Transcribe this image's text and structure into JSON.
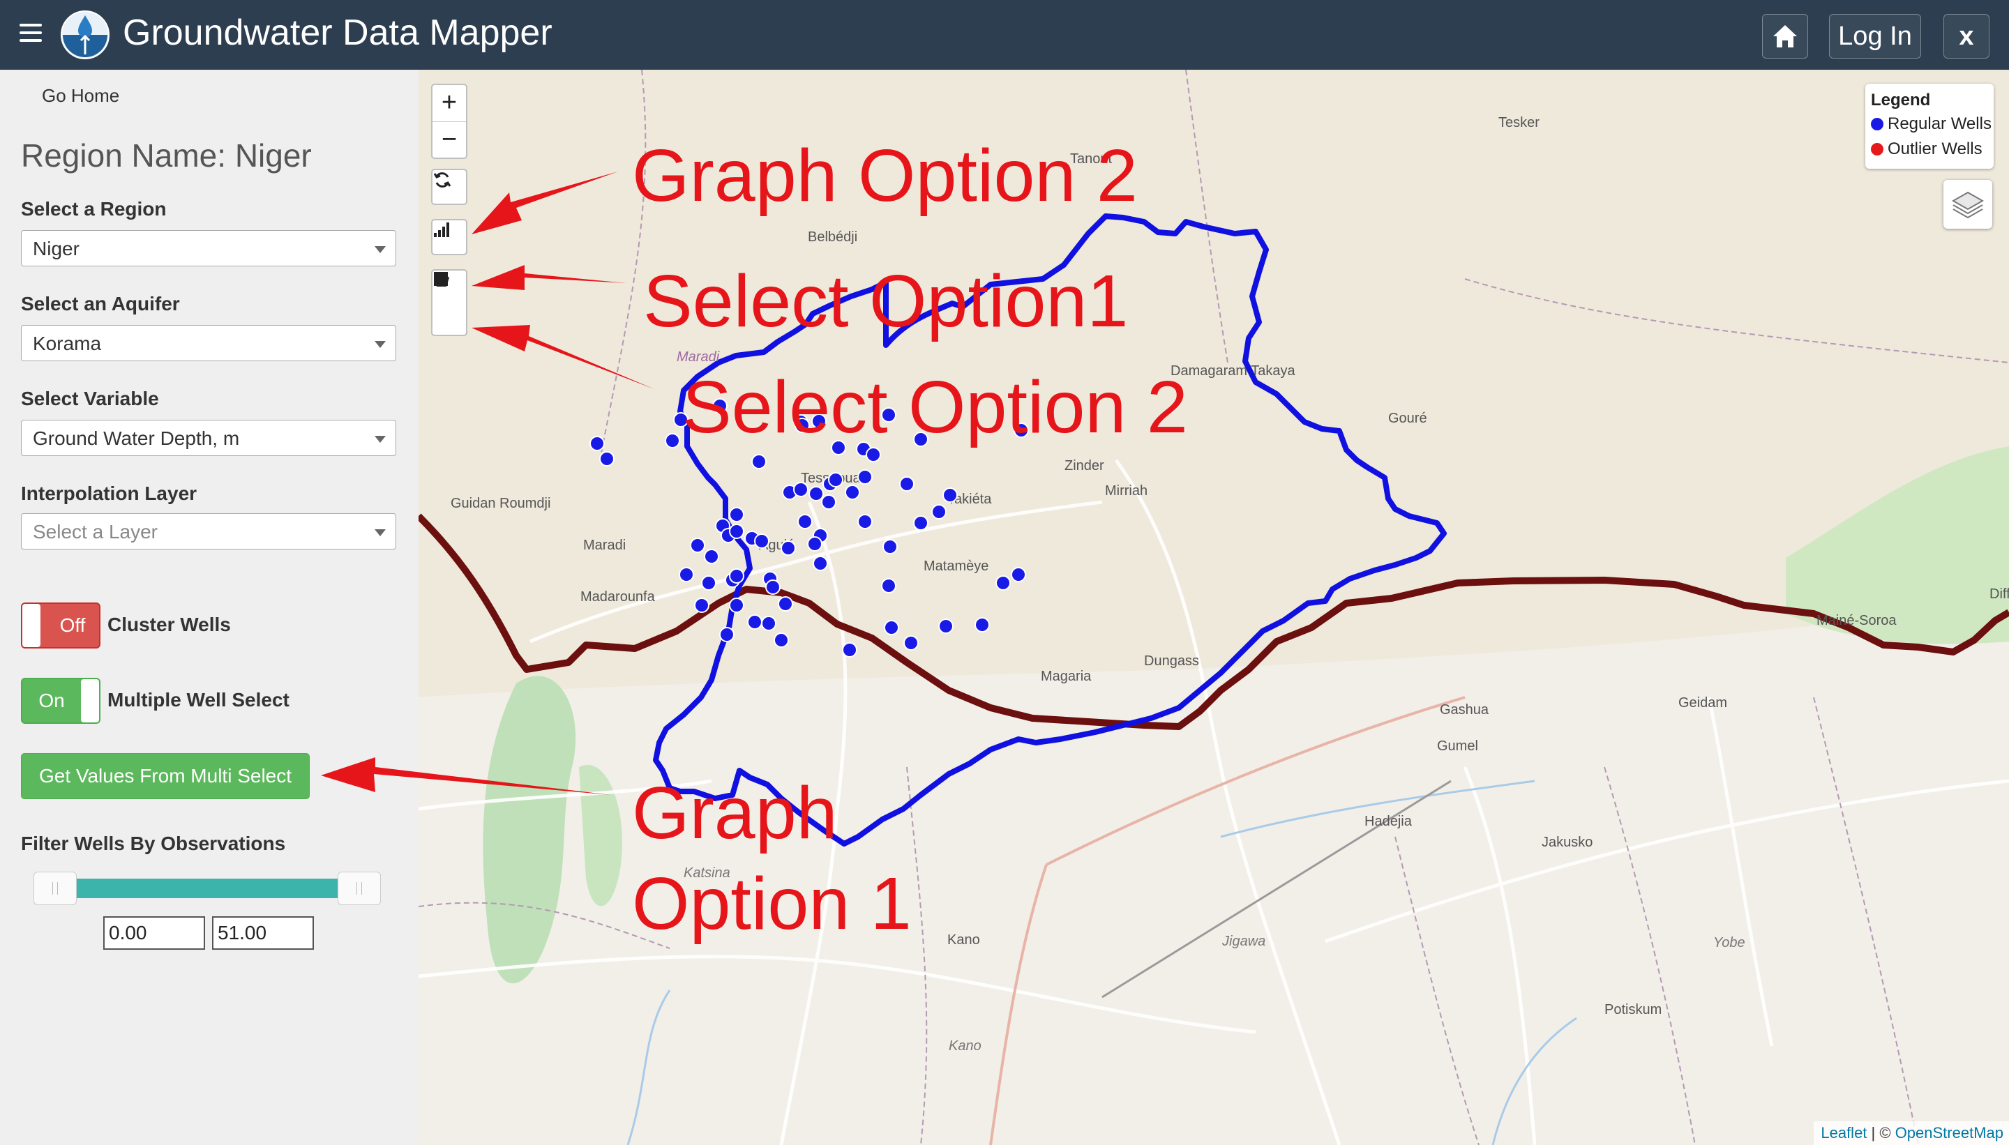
{
  "header": {
    "title": "Groundwater Data Mapper",
    "home_icon": "home-icon",
    "login_label": "Log In",
    "close_label": "x",
    "bar_color": "#2c3e50"
  },
  "sidebar": {
    "go_home": "Go Home",
    "region_name": "Region Name: Niger",
    "region": {
      "label": "Select a Region",
      "value": "Niger"
    },
    "aquifer": {
      "label": "Select an Aquifer",
      "value": "Korama"
    },
    "variable": {
      "label": "Select Variable",
      "value": "Ground Water Depth, m"
    },
    "interpolation": {
      "label": "Interpolation Layer",
      "placeholder": "Select a Layer"
    },
    "cluster_toggle": {
      "state": "Off",
      "label": "Cluster Wells"
    },
    "multi_toggle": {
      "state": "On",
      "label": "Multiple Well Select"
    },
    "get_values_button": "Get Values From Multi Select",
    "filter": {
      "label": "Filter Wells By Observations",
      "min": "0.00",
      "max": "51.00"
    }
  },
  "map": {
    "zoom_in": "+",
    "zoom_out": "−",
    "legend": {
      "title": "Legend",
      "items": [
        {
          "label": "Regular Wells",
          "color": "#1a1ae6"
        },
        {
          "label": "Outlier Wells",
          "color": "#e61a1a"
        }
      ]
    },
    "attribution": {
      "leaflet": "Leaflet",
      "separator": " | © ",
      "osm": "OpenStreetMap"
    },
    "place_labels": [
      "Tesker",
      "Tanout",
      "Belbédji",
      "Maradi",
      "Damagaram Takaya",
      "Gouré",
      "Zinder",
      "Mirriah",
      "Takiéta",
      "Tessaoua",
      "Guidan Roumdji",
      "Maradi",
      "Aguié",
      "Madarounfa",
      "Matamèye",
      "Magaria",
      "Dungass",
      "Mainé-Soroa",
      "Diffa",
      "Geidam",
      "Gashua",
      "Gumel",
      "Hadejia",
      "Jakusko",
      "Katsina",
      "Kano",
      "Jigawa",
      "Yobe",
      "Potiskum",
      "Kano"
    ],
    "aquifer_outline_color": "#1010e0",
    "border_color": "#6b0f0f"
  },
  "annotations": {
    "graph_option_2": "Graph Option 2",
    "select_option_1": "Select Option1",
    "select_option_2": "Select Option 2",
    "graph_option_1_line1": "Graph",
    "graph_option_1_line2": "Option 1",
    "color": "#e5151a"
  }
}
